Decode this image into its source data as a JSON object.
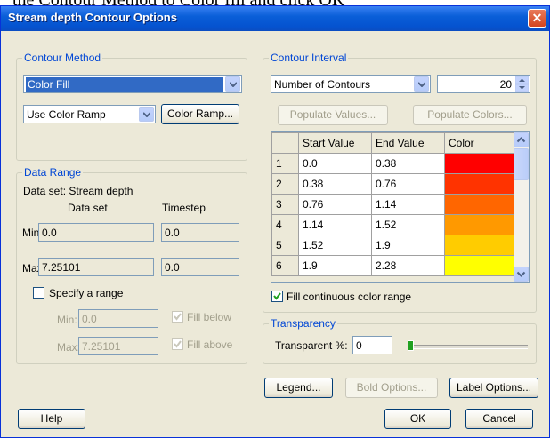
{
  "doc_caption": "the Contour Method to Color fill and click OK",
  "window": {
    "title": "Stream depth Contour Options",
    "close_glyph": "✕"
  },
  "contour_method": {
    "label": "Contour Method",
    "method_value": "Color Fill",
    "ramp_value": "Use Color Ramp",
    "color_ramp_button": "Color Ramp..."
  },
  "data_range": {
    "label": "Data Range",
    "data_set_text": "Data set:  Stream depth",
    "col_data_set": "Data set",
    "col_timestep": "Timestep",
    "min_label": "Min:",
    "max_label": "Max:",
    "min_data_set": "0.0",
    "min_timestep": "0.0",
    "max_data_set": "7.25101",
    "max_timestep": "0.0",
    "specify_range_label": "Specify a range",
    "range_min_label": "Min:",
    "range_max_label": "Max:",
    "range_min_value": "0.0",
    "range_max_value": "7.25101",
    "fill_below_label": "Fill below",
    "fill_above_label": "Fill above"
  },
  "contour_interval": {
    "label": "Contour Interval",
    "type_value": "Number of Contours",
    "count_value": "20",
    "populate_values_button": "Populate Values...",
    "populate_colors_button": "Populate Colors...",
    "table": {
      "headers": [
        "",
        "Start Value",
        "End Value",
        "Color"
      ],
      "rows": [
        {
          "n": "1",
          "start": "0.0",
          "end": "0.38",
          "color": "#ff0000"
        },
        {
          "n": "2",
          "start": "0.38",
          "end": "0.76",
          "color": "#ff3300"
        },
        {
          "n": "3",
          "start": "0.76",
          "end": "1.14",
          "color": "#ff6600"
        },
        {
          "n": "4",
          "start": "1.14",
          "end": "1.52",
          "color": "#ff9900"
        },
        {
          "n": "5",
          "start": "1.52",
          "end": "1.9",
          "color": "#ffcc00"
        },
        {
          "n": "6",
          "start": "1.9",
          "end": "2.28",
          "color": "#ffff00"
        }
      ]
    },
    "fill_continuous_label": "Fill continuous color range"
  },
  "transparency": {
    "label": "Transparency",
    "percent_label": "Transparent %:",
    "percent_value": "0",
    "slider_level": 0
  },
  "buttons": {
    "legend": "Legend...",
    "bold_options": "Bold Options...",
    "label_options": "Label Options...",
    "help": "Help",
    "ok": "OK",
    "cancel": "Cancel"
  },
  "colors": {
    "title_bar": "#0a5fd8",
    "group_label": "#0046d5",
    "selection": "#316ac5"
  }
}
